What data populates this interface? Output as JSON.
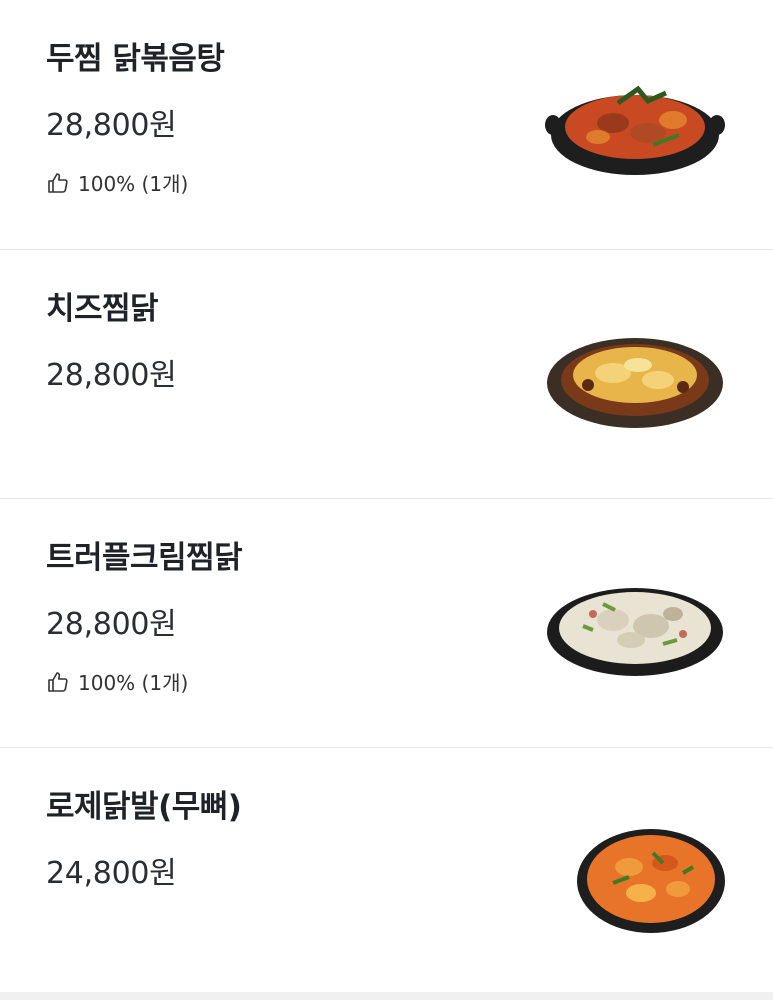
{
  "menu": {
    "items": [
      {
        "name": "두찜 닭볶음탕",
        "price": "28,800원",
        "rating": "100% (1개)",
        "image_icon": "braised-chicken-stew-dish"
      },
      {
        "name": "치즈찜닭",
        "price": "28,800원",
        "rating": "",
        "image_icon": "cheese-braised-chicken-dish"
      },
      {
        "name": "트러플크림찜닭",
        "price": "28,800원",
        "rating": "100% (1개)",
        "image_icon": "truffle-cream-chicken-dish"
      },
      {
        "name": "로제닭발(무뼈)",
        "price": "24,800원",
        "rating": "",
        "image_icon": "rose-chicken-feet-dish"
      }
    ]
  },
  "colors": {
    "text": "#1f2328",
    "divider": "#e6e8eb",
    "sauce_red": "#c94a22",
    "cheese": "#e8b54a",
    "cream": "#e9e3d3",
    "rose": "#e8742a"
  }
}
